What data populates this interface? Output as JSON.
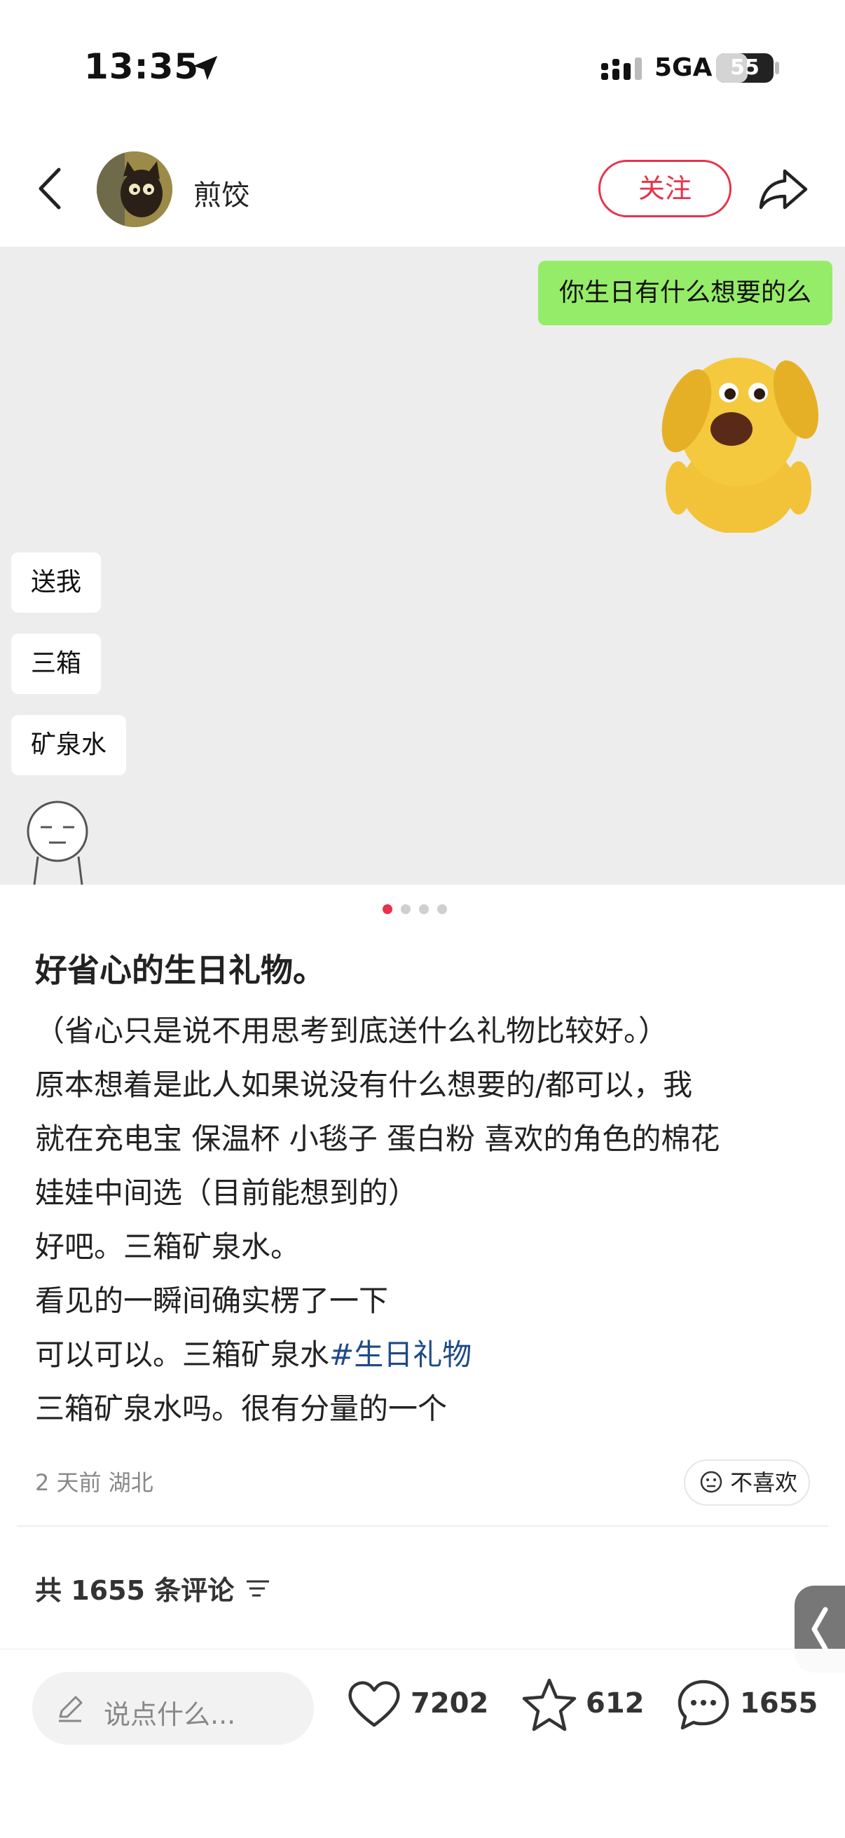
{
  "status_bar": {
    "time": "13:35",
    "network": "5GA",
    "battery": "55",
    "battery_level": 0.55
  },
  "header": {
    "username": "煎饺",
    "follow_label": "关注"
  },
  "image_chat": {
    "sent_message": "你生日有什么想要的么",
    "replies": [
      "送我",
      "三箱",
      "矿泉水"
    ]
  },
  "carousel": {
    "count": 4,
    "active_index": 0
  },
  "post": {
    "title": "好省心的生日礼物。",
    "lines": [
      "（省心只是说不用思考到底送什么礼物比较好。）",
      "原本想着是此人如果说没有什么想要的/都可以，我",
      "就在充电宝 保温杯 小毯子 蛋白粉 喜欢的角色的棉花",
      "娃娃中间选（目前能想到的）",
      "好吧。三箱矿泉水。",
      "看见的一瞬间确实楞了一下"
    ],
    "line_with_tag_text": "可以可以。三箱矿泉水",
    "hashtag": "#生日礼物",
    "last_line": "三箱矿泉水吗。很有分量的一个",
    "meta": "2 天前 湖北",
    "dislike_label": "不喜欢",
    "comment_count_label": "共 1655 条评论"
  },
  "bottom_bar": {
    "comment_placeholder": "说点什么...",
    "likes": "7202",
    "favorites": "612",
    "comments": "1655"
  },
  "colors": {
    "accent": "#e8324a",
    "bubble_green": "#95ec69",
    "hashtag": "#1f4a86"
  }
}
